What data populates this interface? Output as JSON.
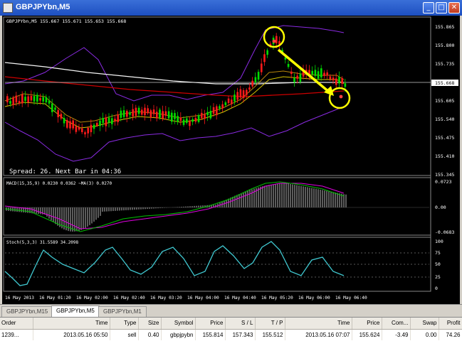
{
  "window": {
    "title": "GBPJPYbn,M5"
  },
  "chart_info": "GBPJPYbn,M5  155.667 155.671 155.653 155.668",
  "spread_text": "Spread: 26. Next Bar in 04:36",
  "price_axis": [
    "155.865",
    "155.800",
    "155.735",
    "155.668",
    "155.605",
    "155.540",
    "155.475",
    "155.410",
    "155.345"
  ],
  "macd": {
    "label": "MACD(15,35,9) 0.0230 0.0362 ~MA(3) 0.0270",
    "axis": [
      "0.0723",
      "0.00",
      "-0.0683"
    ]
  },
  "stoch": {
    "label": "Stoch(5,3,3) 31.5589 34.2098",
    "axis": [
      "100",
      "75",
      "50",
      "25",
      "0"
    ]
  },
  "time_axis": [
    "16 May 2013",
    "16 May 01:20",
    "16 May 02:00",
    "16 May 02:40",
    "16 May 03:20",
    "16 May 04:00",
    "16 May 04:40",
    "16 May 05:20",
    "16 May 06:00",
    "16 May 06:40"
  ],
  "tabs": [
    "GBPJPYbn,M15",
    "GBPJPYbn,M5",
    "GBPJPYbn,M1"
  ],
  "orders": {
    "columns": [
      "Order",
      "Time",
      "Type",
      "Size",
      "Symbol",
      "Price",
      "S / L",
      "T / P",
      "Time",
      "Price",
      "Com...",
      "Swap",
      "Profit"
    ],
    "rows": [
      [
        "1239...",
        "2013.05.16 05:50",
        "sell",
        "0.40",
        "gbpjpybn",
        "155.814",
        "157.343",
        "155.512",
        "2013.05.16 07:07",
        "155.624",
        "-3.49",
        "0.00",
        "74.26"
      ]
    ]
  }
}
